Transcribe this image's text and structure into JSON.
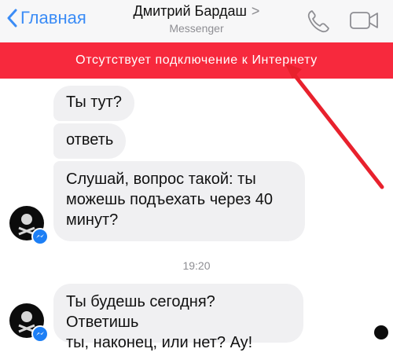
{
  "header": {
    "back_label": "Главная",
    "title": "Дмитрий Бардаш",
    "title_chevron": ">",
    "subtitle": "Messenger",
    "accent_color": "#3b8cf6"
  },
  "banner": {
    "text": "Отсутствует подключение к Интернету",
    "color": "#f7293d"
  },
  "messages": [
    {
      "text": "Ты тут?"
    },
    {
      "text": "ответь"
    },
    {
      "text_lines": [
        "Слушай, вопрос такой: ты",
        "можешь подъехать через 40",
        "минут?"
      ]
    },
    {
      "text_lines": [
        "Ты будешь сегодня? Ответишь",
        "ты, наконец, или нет? Ау!"
      ]
    }
  ],
  "timestamp": "19:20",
  "icons": {
    "back": "chevron-left-icon",
    "call": "phone-icon",
    "video": "video-camera-icon",
    "messenger_badge": "messenger-icon"
  }
}
